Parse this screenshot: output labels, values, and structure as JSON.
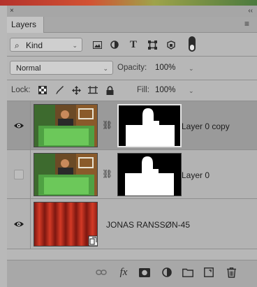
{
  "panel": {
    "title": "Layers",
    "close_glyph": "×",
    "collapse_glyph": "‹‹",
    "menu_glyph": "≡"
  },
  "filter": {
    "kind_label": "Kind",
    "icons": [
      "image-filter-icon",
      "adjustment-filter-icon",
      "type-filter-icon",
      "shape-filter-icon",
      "smart-object-filter-icon",
      "filter-toggle-icon"
    ]
  },
  "blend": {
    "mode": "Normal",
    "opacity_label": "Opacity:",
    "opacity_value": "100%"
  },
  "lock": {
    "label": "Lock:",
    "fill_label": "Fill:",
    "fill_value": "100%"
  },
  "layers": [
    {
      "name": "Layer 0 copy",
      "visible": true,
      "selected": true,
      "has_mask": true
    },
    {
      "name": "Layer 0",
      "visible": false,
      "selected": false,
      "has_mask": true
    },
    {
      "name": "JONAS RANSSØN-45",
      "visible": true,
      "selected": false,
      "has_mask": false
    }
  ],
  "bottom": {
    "fx_label": "fx"
  },
  "colors": {
    "selected_row": "#9a9a9a",
    "panel_bg": "#b7b7b7",
    "curtain": "#b8281c"
  }
}
